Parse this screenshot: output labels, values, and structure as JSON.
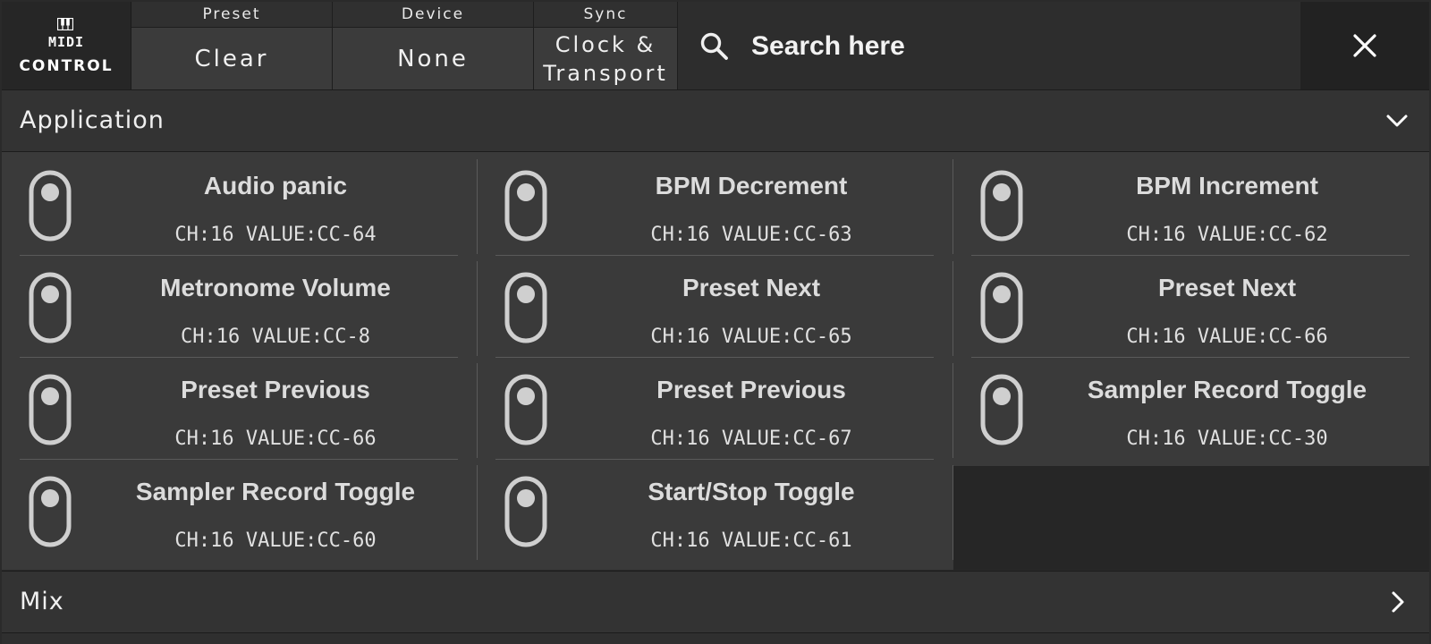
{
  "logo": {
    "line1": "MIDI",
    "line2": "CONTROL"
  },
  "topbar": {
    "preset": {
      "caption": "Preset",
      "value": "Clear"
    },
    "device": {
      "caption": "Device",
      "value": "None"
    },
    "sync": {
      "caption": "Sync",
      "value_line1": "Clock &",
      "value_line2": "Transport"
    },
    "search": {
      "placeholder": "Search here"
    }
  },
  "sections": {
    "application": {
      "title": "Application",
      "expanded": true
    },
    "mix": {
      "title": "Mix",
      "expanded": false
    }
  },
  "mappings": [
    {
      "name": "Audio panic",
      "meta": "CH:16 VALUE:CC-64"
    },
    {
      "name": "BPM Decrement",
      "meta": "CH:16 VALUE:CC-63"
    },
    {
      "name": "BPM Increment",
      "meta": "CH:16 VALUE:CC-62"
    },
    {
      "name": "Metronome Volume",
      "meta": "CH:16 VALUE:CC-8"
    },
    {
      "name": "Preset Next",
      "meta": "CH:16 VALUE:CC-65"
    },
    {
      "name": "Preset Next",
      "meta": "CH:16 VALUE:CC-66"
    },
    {
      "name": "Preset Previous",
      "meta": "CH:16 VALUE:CC-66"
    },
    {
      "name": "Preset Previous",
      "meta": "CH:16 VALUE:CC-67"
    },
    {
      "name": "Sampler Record Toggle",
      "meta": "CH:16 VALUE:CC-30"
    },
    {
      "name": "Sampler Record Toggle",
      "meta": "CH:16 VALUE:CC-60"
    },
    {
      "name": "Start/Stop Toggle",
      "meta": "CH:16 VALUE:CC-61"
    }
  ],
  "icons": {
    "toggle": "toggle-switch-icon",
    "search": "search-icon",
    "close": "close-icon",
    "expand": "chevron-down-icon",
    "collapse": "chevron-right-icon",
    "logo": "piano-keys-icon"
  },
  "colors": {
    "background": "#2a2a2a",
    "grid": "#3a3a3a",
    "text": "#dcdcdc",
    "divider": "#5a5a5a"
  }
}
